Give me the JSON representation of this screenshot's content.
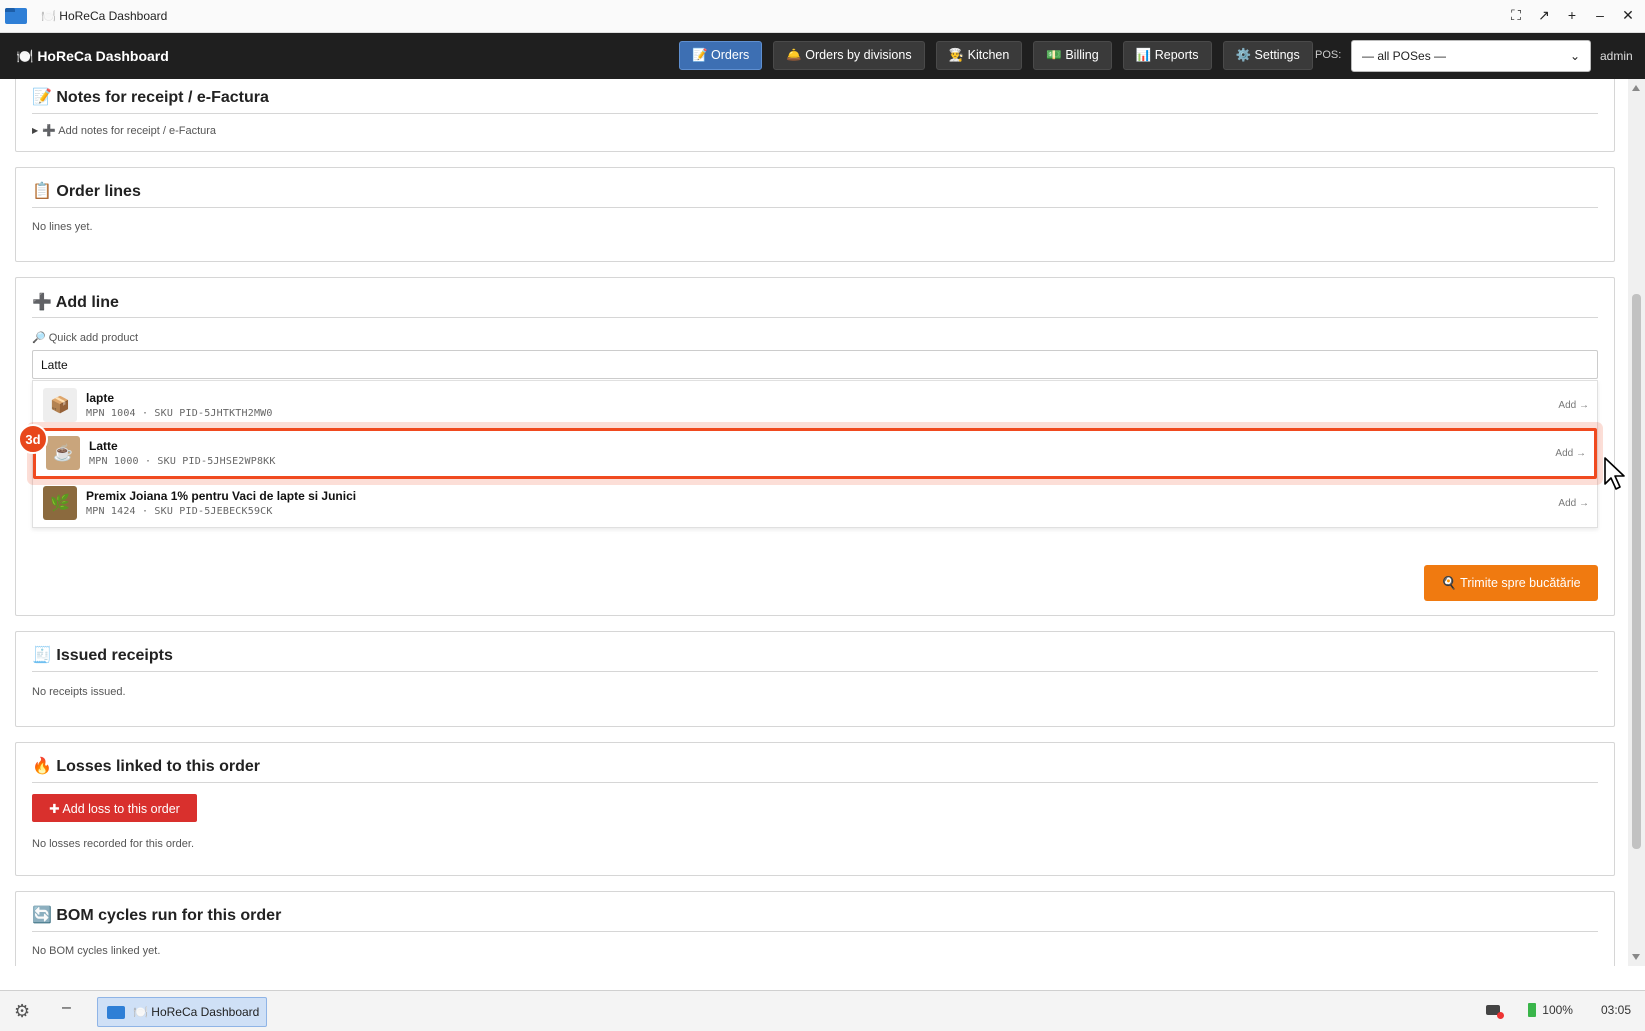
{
  "window": {
    "title": "🍽️ HoReCa Dashboard"
  },
  "header": {
    "brand": "🍽️ HoReCa Dashboard",
    "nav": [
      {
        "label": "📝 Orders",
        "active": true
      },
      {
        "label": "🛎️ Orders by divisions",
        "active": false
      },
      {
        "label": "👨‍🍳 Kitchen",
        "active": false
      },
      {
        "label": "💵 Billing",
        "active": false
      },
      {
        "label": "📊 Reports",
        "active": false
      },
      {
        "label": "⚙️ Settings",
        "active": false
      }
    ],
    "pos_label": "POS:",
    "pos_selected": "— all POSes —",
    "user": "admin"
  },
  "notes": {
    "title": "📝 Notes for receipt / e-Factura",
    "summary": "➕ Add notes for receipt / e-Factura"
  },
  "order_lines": {
    "title": "📋 Order lines",
    "empty": "No lines yet."
  },
  "add_line": {
    "title": "➕ Add line",
    "quick_add_label": "🔎 Quick add product",
    "search_value": "Latte",
    "results": [
      {
        "name": "lapte",
        "meta": "MPN 1004 · SKU PID-5JHTKTH2MW0",
        "action": "Add →",
        "icon": "box-icon",
        "glyph": "📦"
      },
      {
        "name": "Latte",
        "meta": "MPN 1000 · SKU PID-5JHSE2WP8KK",
        "action": "Add →",
        "icon": "latte-photo",
        "glyph": "☕"
      },
      {
        "name": "Premix Joiana 1% pentru Vaci de lapte si Junici",
        "meta": "MPN 1424 · SKU PID-5JEBECK59CK",
        "action": "Add →",
        "icon": "product-photo",
        "glyph": "🌿"
      }
    ],
    "highlight_badge": "3d",
    "kitchen_button": "🍳 Trimite spre bucătărie"
  },
  "receipts": {
    "title": "🧾 Issued receipts",
    "empty": "No receipts issued."
  },
  "losses": {
    "title": "🔥 Losses linked to this order",
    "button": "✚ Add loss to this order",
    "empty": "No losses recorded for this order."
  },
  "bom": {
    "title": "🔄 BOM cycles run for this order",
    "empty": "No BOM cycles linked yet."
  },
  "taskbar": {
    "task_label": "🍽️ HoReCa Dashboard",
    "battery": "100%",
    "clock": "03:05"
  },
  "colors": {
    "accent_active_nav": "#3d6fb3",
    "highlight": "#f04a1f",
    "kitchen_button": "#f07a10",
    "loss_button": "#d9302d"
  }
}
